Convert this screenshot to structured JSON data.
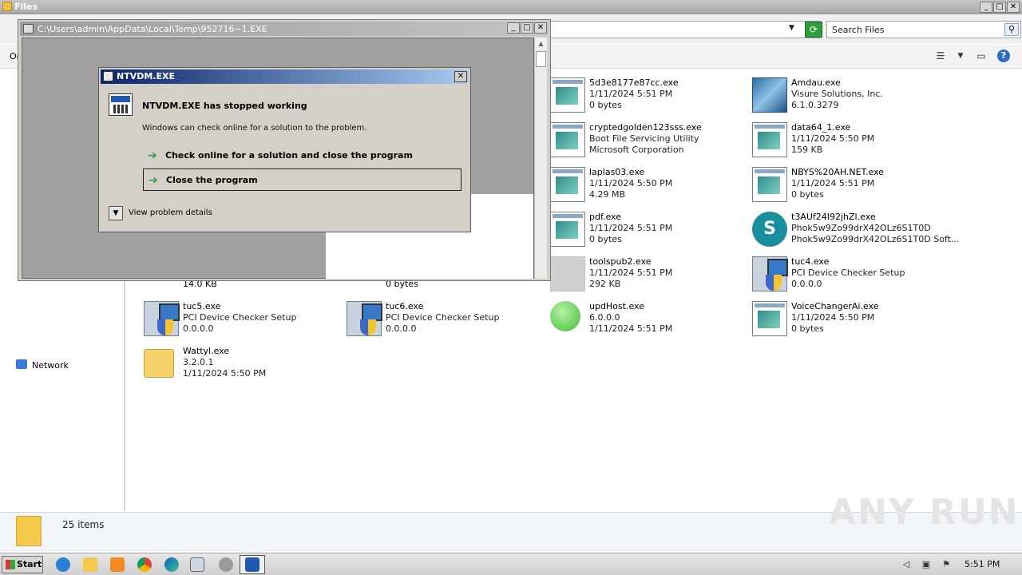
{
  "explorer": {
    "title": "Files",
    "search_placeholder": "Search Files",
    "organize_label": "Or",
    "status_count": "25 items",
    "nav_network": "Network"
  },
  "items": [
    {
      "name": "5d3e8177e87cc.exe",
      "l2": "1/11/2024 5:51 PM",
      "l3": "0 bytes",
      "icon": "exe-icon"
    },
    {
      "name": "Amdau.exe",
      "l2": "Visure Solutions, Inc.",
      "l3": "6.1.0.3279",
      "icon": "amdau-icon"
    },
    {
      "name": "cryptedgolden123sss.exe",
      "l2": "Boot File Servicing Utility",
      "l3": "Microsoft Corporation",
      "icon": "exe-icon"
    },
    {
      "name": "data64_1.exe",
      "l2": "1/11/2024 5:50 PM",
      "l3": "159 KB",
      "icon": "exe-icon"
    },
    {
      "name": "laplas03.exe",
      "l2": "1/11/2024 5:50 PM",
      "l3": "4.29 MB",
      "icon": "exe-icon"
    },
    {
      "name": "NBYS%20AH.NET.exe",
      "l2": "1/11/2024 5:51 PM",
      "l3": "0 bytes",
      "icon": "exe-icon"
    },
    {
      "name": "pdf.exe",
      "l2": "1/11/2024 5:51 PM",
      "l3": "0 bytes",
      "icon": "exe-icon"
    },
    {
      "name": "t3AUf24I92jhZl.exe",
      "l2": "Phok5w9Zo99drX42OLz6S1T0D",
      "l3": "Phok5w9Zo99drX42OLz6S1T0D Soft...",
      "icon": "surfshark-icon"
    },
    {
      "name": "toolspub2.exe",
      "l2": "1/11/2024 5:51 PM",
      "l3": "292 KB",
      "icon": "blurred-icon"
    },
    {
      "name": "tuc4.exe",
      "l2": "PCI Device Checker Setup",
      "l3": "0.0.0.0",
      "icon": "installer-icon"
    },
    {
      "name": "",
      "l2": "14.0 KB",
      "l3": "",
      "icon": ""
    },
    {
      "name": "",
      "l2": "0 bytes",
      "l3": "",
      "icon": ""
    },
    {
      "name": "tuc5.exe",
      "l2": "PCI Device Checker Setup",
      "l3": "0.0.0.0",
      "icon": "installer-icon"
    },
    {
      "name": "tuc6.exe",
      "l2": "PCI Device Checker Setup",
      "l3": "0.0.0.0",
      "icon": "installer-icon"
    },
    {
      "name": "updHost.exe",
      "l2": "6.0.0.0",
      "l3": "1/11/2024 5:51 PM",
      "icon": "green-orb-icon"
    },
    {
      "name": "VoiceChangerAi.exe",
      "l2": "1/11/2024 5:50 PM",
      "l3": "0 bytes",
      "icon": "exe-icon"
    },
    {
      "name": "Wattyl.exe",
      "l2": "3.2.0.1",
      "l3": "1/11/2024 5:50 PM",
      "icon": "folder-icon"
    }
  ],
  "console": {
    "title": "C:\\Users\\admin\\AppData\\Local\\Temp\\952716~1.EXE"
  },
  "dialog": {
    "title": "NTVDM.EXE",
    "heading": "NTVDM.EXE has stopped working",
    "subtext": "Windows can check online for a solution to the problem.",
    "option1": "Check online for a solution and close the program",
    "option2": "Close the program",
    "details": "View problem details"
  },
  "taskbar": {
    "start": "Start",
    "clock": "5:51 PM"
  },
  "watermark": "ANY RUN"
}
